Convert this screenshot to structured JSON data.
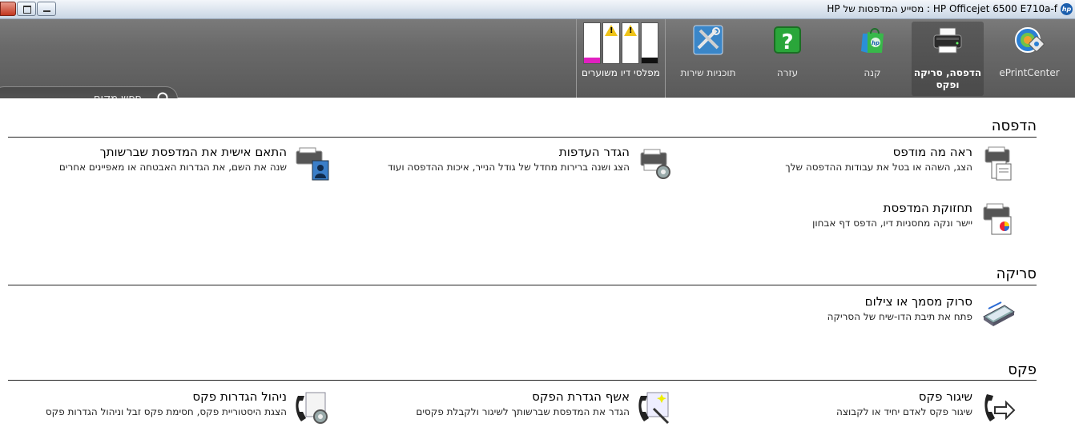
{
  "window": {
    "title": "HP Officejet 6500 E710a-f : מסייע המדפסות של HP"
  },
  "toolbar": {
    "items": [
      {
        "label": "ePrintCenter",
        "icon": "eprint-center-icon"
      },
      {
        "label": "הדפסה, סריקה ופקס",
        "icon": "printer-icon",
        "selected": true
      },
      {
        "label": "קנה",
        "icon": "shopping-bag-icon"
      },
      {
        "label": "עזרה",
        "icon": "help-icon"
      },
      {
        "label": "תוכניות שירות",
        "icon": "tools-icon"
      }
    ],
    "ink": {
      "label": "מפלסי דיו משוערים",
      "cartridges": [
        {
          "color": "#e020c0",
          "level": 0.15,
          "warning": false
        },
        {
          "color": "#f0e000",
          "level": 0.0,
          "warning": true
        },
        {
          "color": "#00c0f0",
          "level": 0.0,
          "warning": true
        },
        {
          "color": "#111111",
          "level": 0.15,
          "warning": false
        }
      ]
    },
    "search": {
      "placeholder": "חפש מקום"
    }
  },
  "sections": {
    "print": {
      "title": "הדפסה",
      "items": [
        {
          "title": "ראה מה מודפס",
          "desc": "הצג, השהה או בטל את עבודות ההדפסה שלך"
        },
        {
          "title": "הגדר העדפות",
          "desc": "הצג ושנה ברירות מחדל של גודל הנייר, איכות ההדפסה ועוד"
        },
        {
          "title": "התאם אישית את המדפסת שברשותך",
          "desc": "שנה את השם, את הגדרות האבטחה או מאפיינים אחרים"
        },
        {
          "title": "תחזוקת המדפסת",
          "desc": "יישר ונקה מחסניות דיו, הדפס דף אבחון"
        }
      ]
    },
    "scan": {
      "title": "סריקה",
      "items": [
        {
          "title": "סרוק מסמך או צילום",
          "desc": "פתח את תיבת הדו-שיח של הסריקה"
        }
      ]
    },
    "fax": {
      "title": "פקס",
      "items": [
        {
          "title": "שיגור פקס",
          "desc": "שיגור פקס לאדם יחיד או לקבוצה"
        },
        {
          "title": "אשף הגדרת הפקס",
          "desc": "הגדר את המדפסת שברשותך לשיגור ולקבלת פקסים"
        },
        {
          "title": "ניהול הגדרות פקס",
          "desc": "הצגת היסטוריית פקס, חסימת פקס זבל וניהול הגדרות פקס"
        }
      ]
    }
  }
}
